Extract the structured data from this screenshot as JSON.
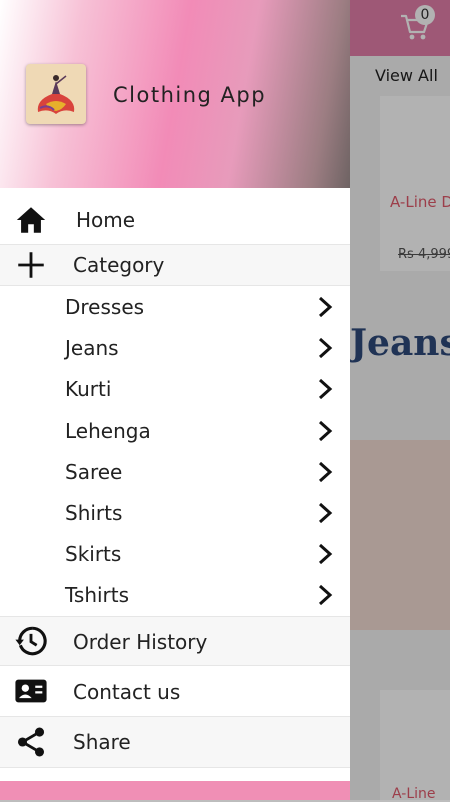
{
  "background": {
    "cart_count": "0",
    "view_all": "View All",
    "product_title": "A-Line D",
    "product_price": "Rs 4,999",
    "banner_text": "Jeans",
    "product2_title": "A-Line"
  },
  "drawer": {
    "app_name": "Clothing App",
    "home": "Home",
    "category": "Category",
    "categories": [
      "Dresses",
      "Jeans",
      "Kurti",
      "Lehenga",
      "Saree",
      "Shirts",
      "Skirts",
      "Tshirts"
    ],
    "order_history": "Order History",
    "contact_us": "Contact us",
    "share": "Share"
  },
  "icons": {
    "home": "home-icon",
    "category": "plus-icon",
    "chevron": "chevron-right-icon",
    "order_history": "history-icon",
    "contact_us": "contact-card-icon",
    "share": "share-icon",
    "cart": "cart-icon"
  },
  "colors": {
    "accent_pink": "#f28bb7",
    "topbar": "#e27fa9",
    "product_title": "#e05a6b",
    "banner_text": "#2f4a7a"
  }
}
